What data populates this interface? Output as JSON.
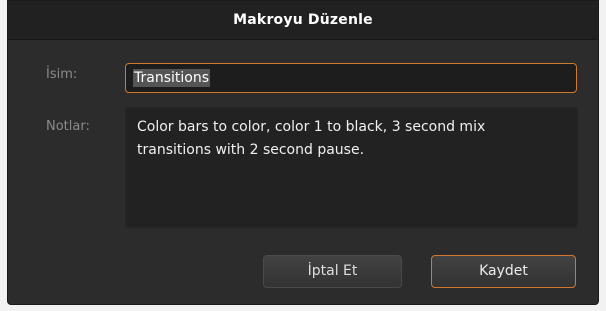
{
  "dialog": {
    "title": "Makroyu Düzenle"
  },
  "form": {
    "name_label": "İsim:",
    "name_value": "Transitions",
    "notes_label": "Notlar:",
    "notes_value": "Color bars to color, color 1 to black, 3 second mix transitions with 2 second pause."
  },
  "buttons": {
    "cancel_label": "İptal Et",
    "save_label": "Kaydet"
  },
  "colors": {
    "accent": "#d0782e",
    "dialog_bg": "#2c2c2c",
    "titlebar_bg": "#212121",
    "field_bg": "#1d1d1d"
  }
}
